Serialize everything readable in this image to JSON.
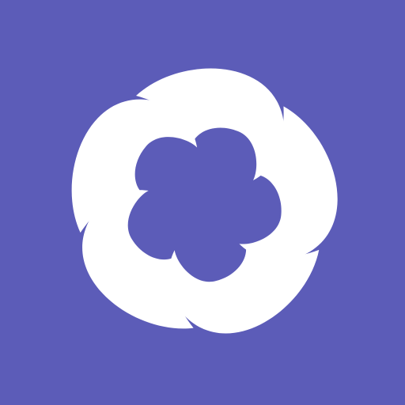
{
  "app_icon": {
    "background_color": "#5c5cb8",
    "foreground_color": "#ffffff",
    "icon_name": "five-petal-swirl-logo-icon"
  }
}
